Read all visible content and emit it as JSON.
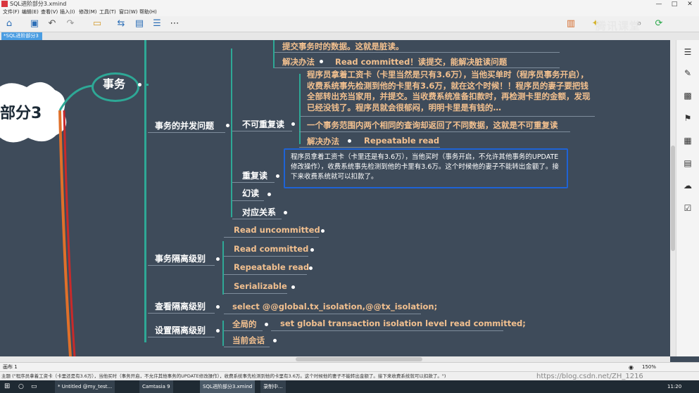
{
  "window": {
    "title": "SQL进阶部分3.xmind",
    "controls": [
      "—",
      "□",
      "✕"
    ]
  },
  "menu": [
    "文件(F)",
    "编辑(E)",
    "查看(V)",
    "插入(I)",
    "修改(M)",
    "工具(T)",
    "窗口(W)",
    "帮助(H)"
  ],
  "tab": {
    "label": "*SQL进阶部分3 ✕"
  },
  "map": {
    "root": "部分3",
    "topic": "事务",
    "concurrency": {
      "label": "事务的并发问题",
      "top_fragment": "提交事务时的数据。这就是脏读。",
      "dirty_solution_label": "解决办法",
      "dirty_solution_value": "Read committed！读提交，能解决脏读问题",
      "nonrepeat_story": "程序员拿着工资卡（卡里当然是只有3.6万），当他买单时（程序员事务开启），收费系统事先检测到他的卡里有3.6万，就在这个时候！！程序员的妻子要把钱全部转出充当家用，并提交。当收费系统准备扣款时，再检测卡里的金额，发现已经没钱了。程序员就会很郁闷，明明卡里是有钱的…",
      "nonrepeat_label": "不可重复读",
      "nonrepeat_def": "一个事务范围内两个相同的查询却返回了不同数据，这就是不可重复读",
      "nonrepeat_solution_label": "解决办法",
      "nonrepeat_solution_value": "Repeatable read",
      "repeat_label": "重复读",
      "repeat_note": "程序员拿着工资卡（卡里还是有3.6万），当他买时（事务开启，不允许其他事务的UPDATE修改操作），收费系统事先检测到他的卡里有3.6万。这个时候他的妻子不能转出金额了。接下来收费系统就可以扣款了。",
      "phantom_label": "幻读",
      "mapping_label": "对应关系"
    },
    "isolation": {
      "label": "事务隔离级别",
      "levels": [
        "Read uncommitted",
        "Read committed",
        "Repeatable read",
        "Serializable"
      ]
    },
    "view": {
      "label": "查看隔离级别",
      "sql": "select @@global.tx_isolation,@@tx_isolation;"
    },
    "set": {
      "label": "设置隔离级别",
      "global_label": "全局的",
      "global_sql": "set global transaction isolation level read committed;",
      "session_label": "当前会话"
    }
  },
  "watermark": "腾讯课堂",
  "bottom_tab": "画布 1",
  "status_text": "主题 (\"程序员拿着工资卡（卡里还是有3.6万），当他买时（事务开启，不允许其他事务的UPDATE修改操作），收费系统事先检测到他的卡里有3.6万。这个时候他的妻子不能转出金额了。接下来收费系统就可以扣款了。\")",
  "zoom": "150%",
  "url_watermark": "https://blog.csdn.net/ZH_1216",
  "taskbar": {
    "items": [
      "* Untitled @my_test...",
      "Camtasia 9",
      "SQL进阶部分3.xmind",
      "录制中..."
    ],
    "time": "11:20"
  },
  "colors": {
    "canvas": "#3e4b5a",
    "branch": "#2ea896",
    "accent": "#f2c08f",
    "note_border": "#1e63d6"
  }
}
